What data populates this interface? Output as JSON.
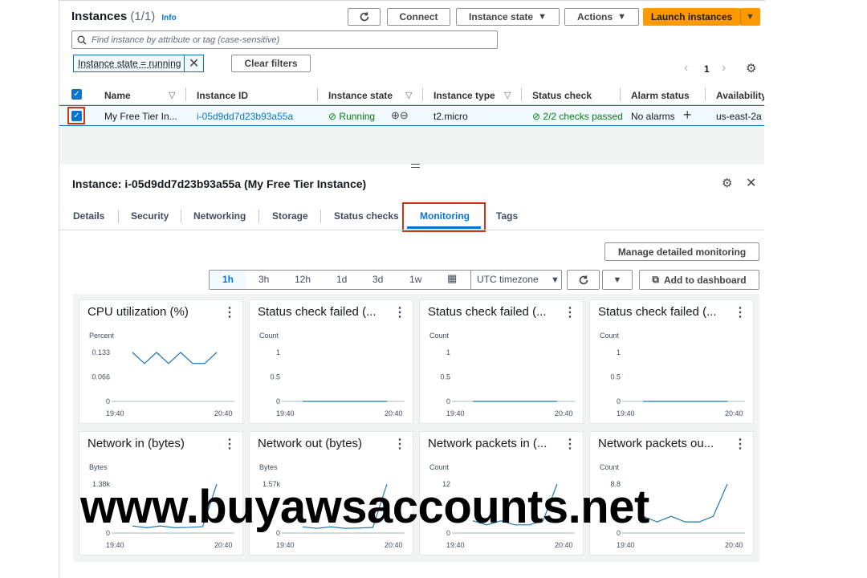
{
  "header": {
    "title": "Instances",
    "count": "(1/1)",
    "info": "Info",
    "refresh_icon": "refresh-icon",
    "connect": "Connect",
    "instance_state": "Instance state",
    "actions": "Actions",
    "launch": "Launch instances"
  },
  "search": {
    "placeholder": "Find instance by attribute or tag (case-sensitive)"
  },
  "filter": {
    "token": "Instance state = running",
    "clear": "Clear filters"
  },
  "pagination": {
    "page": "1"
  },
  "table": {
    "headers": [
      "Name",
      "Instance ID",
      "Instance state",
      "Instance type",
      "Status check",
      "Alarm status",
      "Availability"
    ],
    "row": {
      "name": "My Free Tier In...",
      "instance_id": "i-05d9dd7d23b93a55a",
      "state": "Running",
      "type": "t2.micro",
      "status_check": "2/2 checks passed",
      "alarm": "No alarms",
      "az": "us-east-2a"
    }
  },
  "detail": {
    "title": "Instance: i-05d9dd7d23b93a55a (My Free Tier Instance)",
    "tabs": [
      "Details",
      "Security",
      "Networking",
      "Storage",
      "Status checks",
      "Monitoring",
      "Tags"
    ],
    "active_tab": "Monitoring",
    "manage_monitoring": "Manage detailed monitoring",
    "ranges": [
      "1h",
      "3h",
      "12h",
      "1d",
      "3d",
      "1w"
    ],
    "active_range": "1h",
    "timezone": "UTC timezone",
    "add_dashboard": "Add to dashboard"
  },
  "colors": {
    "accent": "#0972d3",
    "launch": "#ff9900",
    "success": "#037f0c",
    "highlight": "#d13212",
    "line": "#1f77b4"
  },
  "watermark": "www.buyawsaccounts.net",
  "cards": [
    {
      "title": "CPU utilization (%)",
      "unit": "Percent",
      "yticks": [
        "0.133",
        "0.066",
        "0"
      ],
      "x_start": "19:40",
      "x_end": "20:40",
      "ymax": 0.133,
      "values": [
        0.133,
        0.103,
        0.133,
        0.103,
        0.133,
        0.103,
        0.103,
        0.133
      ]
    },
    {
      "title": "Status check failed (...",
      "unit": "Count",
      "yticks": [
        "1",
        "0.5",
        "0"
      ],
      "x_start": "19:40",
      "x_end": "20:40",
      "ymax": 1,
      "values": [
        0,
        0
      ]
    },
    {
      "title": "Status check failed (...",
      "unit": "Count",
      "yticks": [
        "1",
        "0.5",
        "0"
      ],
      "x_start": "19:40",
      "x_end": "20:40",
      "ymax": 1,
      "values": [
        0,
        0
      ]
    },
    {
      "title": "Status check failed (...",
      "unit": "Count",
      "yticks": [
        "1",
        "0.5",
        "0"
      ],
      "x_start": "19:40",
      "x_end": "20:40",
      "ymax": 1,
      "values": [
        0,
        0
      ]
    },
    {
      "title": "Network in (bytes)",
      "unit": "Bytes",
      "yticks": [
        "1.38k",
        "",
        "0"
      ],
      "x_start": "19:40",
      "x_end": "20:40",
      "ymax": 1380,
      "values": [
        200,
        150,
        200,
        150,
        160,
        180,
        1380
      ]
    },
    {
      "title": "Network out (bytes)",
      "unit": "Bytes",
      "yticks": [
        "1.57k",
        "",
        "0"
      ],
      "x_start": "19:40",
      "x_end": "20:40",
      "ymax": 1570,
      "values": [
        200,
        150,
        200,
        150,
        160,
        180,
        1570
      ]
    },
    {
      "title": "Network packets in (...",
      "unit": "Count",
      "yticks": [
        "12",
        "",
        "0"
      ],
      "x_start": "19:40",
      "x_end": "20:40",
      "ymax": 12,
      "values": [
        3,
        2,
        3,
        2,
        2,
        3,
        12
      ]
    },
    {
      "title": "Network packets ou...",
      "unit": "Count",
      "yticks": [
        "8.8",
        "",
        "0"
      ],
      "x_start": "19:40",
      "x_end": "20:40",
      "ymax": 8.8,
      "values": [
        3,
        2,
        3,
        2,
        2,
        3,
        8.8
      ]
    }
  ]
}
